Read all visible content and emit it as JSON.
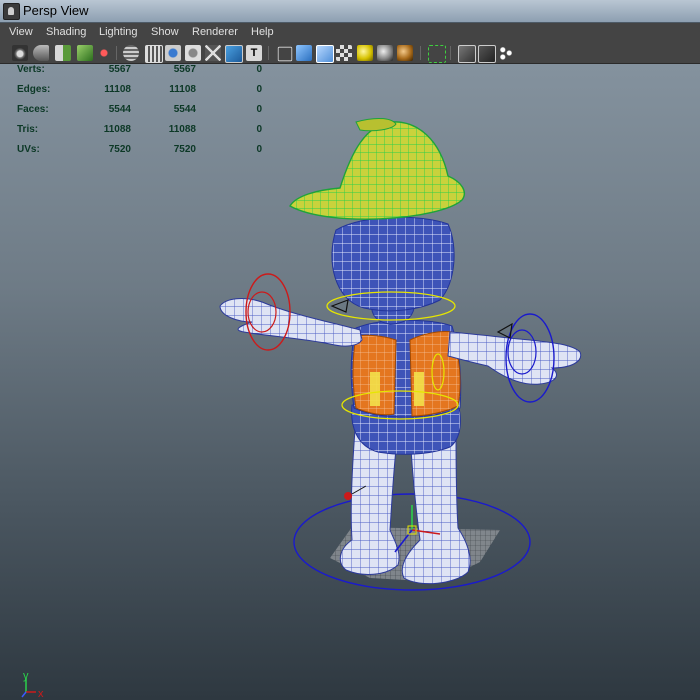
{
  "window": {
    "title": "Persp View"
  },
  "menu": [
    "View",
    "Shading",
    "Lighting",
    "Show",
    "Renderer",
    "Help"
  ],
  "toolbar": {
    "icons": [
      "select-camera-icon",
      "camera-attributes-icon",
      "bookmark-icon",
      "image-plane-icon",
      "two-d-pan-zoom-icon",
      "grease-pencil-icon",
      "grid-icon",
      "film-gate-icon",
      "resolution-gate-icon",
      "gate-mask-icon",
      "field-chart-icon",
      "safe-action-icon",
      "safe-title-icon",
      "wireframe-icon",
      "smooth-shade-icon",
      "wireframe-on-shaded-icon",
      "textured-icon",
      "use-all-lights-icon",
      "shadows-icon",
      "ambient-occlusion-icon",
      "isolate-select-icon",
      "xray-icon",
      "xray-joints-icon",
      "backface-culling-icon"
    ]
  },
  "hud": {
    "rows": [
      {
        "label": "Verts:",
        "v1": "5567",
        "v2": "5567",
        "v3": "0"
      },
      {
        "label": "Edges:",
        "v1": "11108",
        "v2": "11108",
        "v3": "0"
      },
      {
        "label": "Faces:",
        "v1": "5544",
        "v2": "5544",
        "v3": "0"
      },
      {
        "label": "Tris:",
        "v1": "11088",
        "v2": "11088",
        "v3": "0"
      },
      {
        "label": "UVs:",
        "v1": "7520",
        "v2": "7520",
        "v3": "0"
      }
    ]
  },
  "axis": {
    "y_label": "y",
    "x_label": "x",
    "z_label": "z"
  },
  "colors": {
    "hud_text": "#0c3826",
    "mesh_blue": "#3e54b8",
    "helmet_yellow": "#c9d23c",
    "vest_orange": "#e4761f",
    "control_red": "#cc1a1a",
    "control_blue": "#1a1acc",
    "control_yellow": "#e6e600"
  }
}
